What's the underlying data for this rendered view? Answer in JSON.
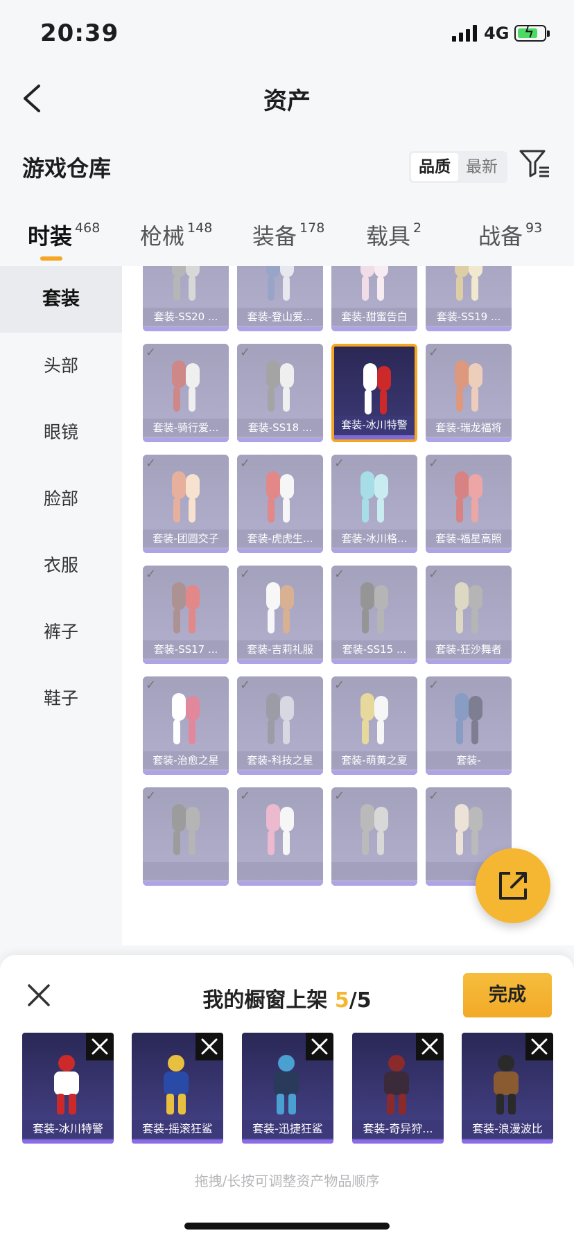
{
  "status_bar": {
    "time": "20:39",
    "network": "4G"
  },
  "nav": {
    "title": "资产"
  },
  "warehouse": {
    "title": "游戏仓库",
    "sort_options": [
      "品质",
      "最新"
    ],
    "active_sort": "品质"
  },
  "tabs": [
    {
      "label": "时装",
      "count": "468",
      "active": true
    },
    {
      "label": "枪械",
      "count": "148"
    },
    {
      "label": "装备",
      "count": "178"
    },
    {
      "label": "载具",
      "count": "2"
    },
    {
      "label": "战备",
      "count": "93"
    }
  ],
  "sidebar": [
    {
      "label": "套装",
      "active": true
    },
    {
      "label": "头部"
    },
    {
      "label": "眼镜"
    },
    {
      "label": "脸部"
    },
    {
      "label": "衣服"
    },
    {
      "label": "裤子"
    },
    {
      "label": "鞋子"
    }
  ],
  "grid": [
    {
      "name": "套装-SS20 ..."
    },
    {
      "name": "套装-登山爱..."
    },
    {
      "name": "套装-甜蜜告白"
    },
    {
      "name": "套装-SS19 ..."
    },
    {
      "name": "套装-骑行爱..."
    },
    {
      "name": "套装-SS18 ..."
    },
    {
      "name": "套装-冰川特警",
      "selected": true
    },
    {
      "name": "套装-瑞龙福将"
    },
    {
      "name": "套装-团圆交子"
    },
    {
      "name": "套装-虎虎生..."
    },
    {
      "name": "套装-冰川格..."
    },
    {
      "name": "套装-福星高照"
    },
    {
      "name": "套装-SS17 ..."
    },
    {
      "name": "套装-吉莉礼服"
    },
    {
      "name": "套装-SS15 ..."
    },
    {
      "name": "套装-狂沙舞者"
    },
    {
      "name": "套装-治愈之星"
    },
    {
      "name": "套装-科技之星"
    },
    {
      "name": "套装-萌黄之夏"
    },
    {
      "name": "套装-"
    },
    {
      "name": ""
    },
    {
      "name": ""
    },
    {
      "name": ""
    },
    {
      "name": ""
    }
  ],
  "sheet": {
    "title_prefix": "我的橱窗上架 ",
    "current": "5",
    "max": "/5",
    "done_label": "完成",
    "picked": [
      {
        "name": "套装-冰川特警"
      },
      {
        "name": "套装-摇滚狂鲨"
      },
      {
        "name": "套装-迅捷狂鲨"
      },
      {
        "name": "套装-奇异狩..."
      },
      {
        "name": "套装-浪漫波比"
      }
    ],
    "hint": "拖拽/长按可调整资产物品顺序"
  },
  "colors": {
    "accent": "#f5b731",
    "card": "#6b6893",
    "selected_border": "#f5a623"
  }
}
